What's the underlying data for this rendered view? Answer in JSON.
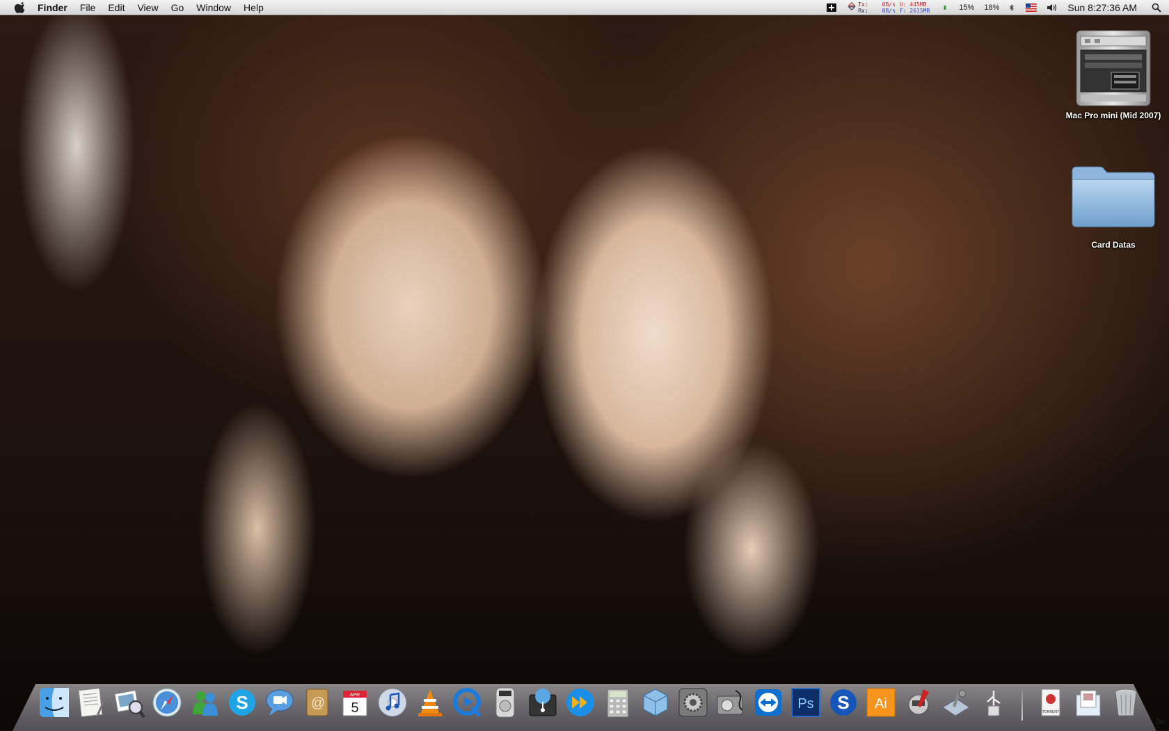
{
  "menubar": {
    "app_name": "Finder",
    "menus": [
      "File",
      "Edit",
      "View",
      "Go",
      "Window",
      "Help"
    ],
    "status": {
      "tx_label": "Tx:",
      "rx_label": "Rx:",
      "tx_rate": "0B/s",
      "rx_rate": "0B/s",
      "mem_used": "U: 445MB",
      "mem_free": "F: 2615MB",
      "cpu1": "15%",
      "cpu2": "18%",
      "clock": "Sun 8:27:36 AM"
    },
    "icons": [
      "istat-icon",
      "network-icon",
      "battery-icon",
      "bluetooth-icon",
      "us-flag-icon",
      "volume-icon",
      "spotlight-icon"
    ]
  },
  "desktop": {
    "items": [
      {
        "label": "Mac Pro mini (Mid 2007)",
        "icon": "mac-pro-icon"
      },
      {
        "label": "Card Datas",
        "icon": "folder-icon"
      }
    ]
  },
  "dock": {
    "apps": [
      "finder-icon",
      "textedit-icon",
      "preview-icon",
      "safari-icon",
      "messenger-icon",
      "skype-icon",
      "ichat-icon",
      "address-book-icon",
      "ical-icon",
      "itunes-icon",
      "vlc-icon",
      "quicktime-icon",
      "dvd-player-icon",
      "time-machine-icon",
      "fast-forward-icon",
      "calculator-icon",
      "virtual-box-icon",
      "system-preferences-icon",
      "disk-utility-icon",
      "teamviewer-icon",
      "photoshop-icon",
      "shazam-icon",
      "illustrator-icon",
      "automator-icon",
      "xcode-icon",
      "usb-icon"
    ],
    "ical_date": "5",
    "ical_month": "APR",
    "ps_label": "Ps",
    "ai_label": "Ai",
    "stacks": [
      "torrent-icon",
      "documents-icon",
      "trash-icon"
    ],
    "torrent_label": "TORRENT"
  },
  "corner_mark": "be"
}
